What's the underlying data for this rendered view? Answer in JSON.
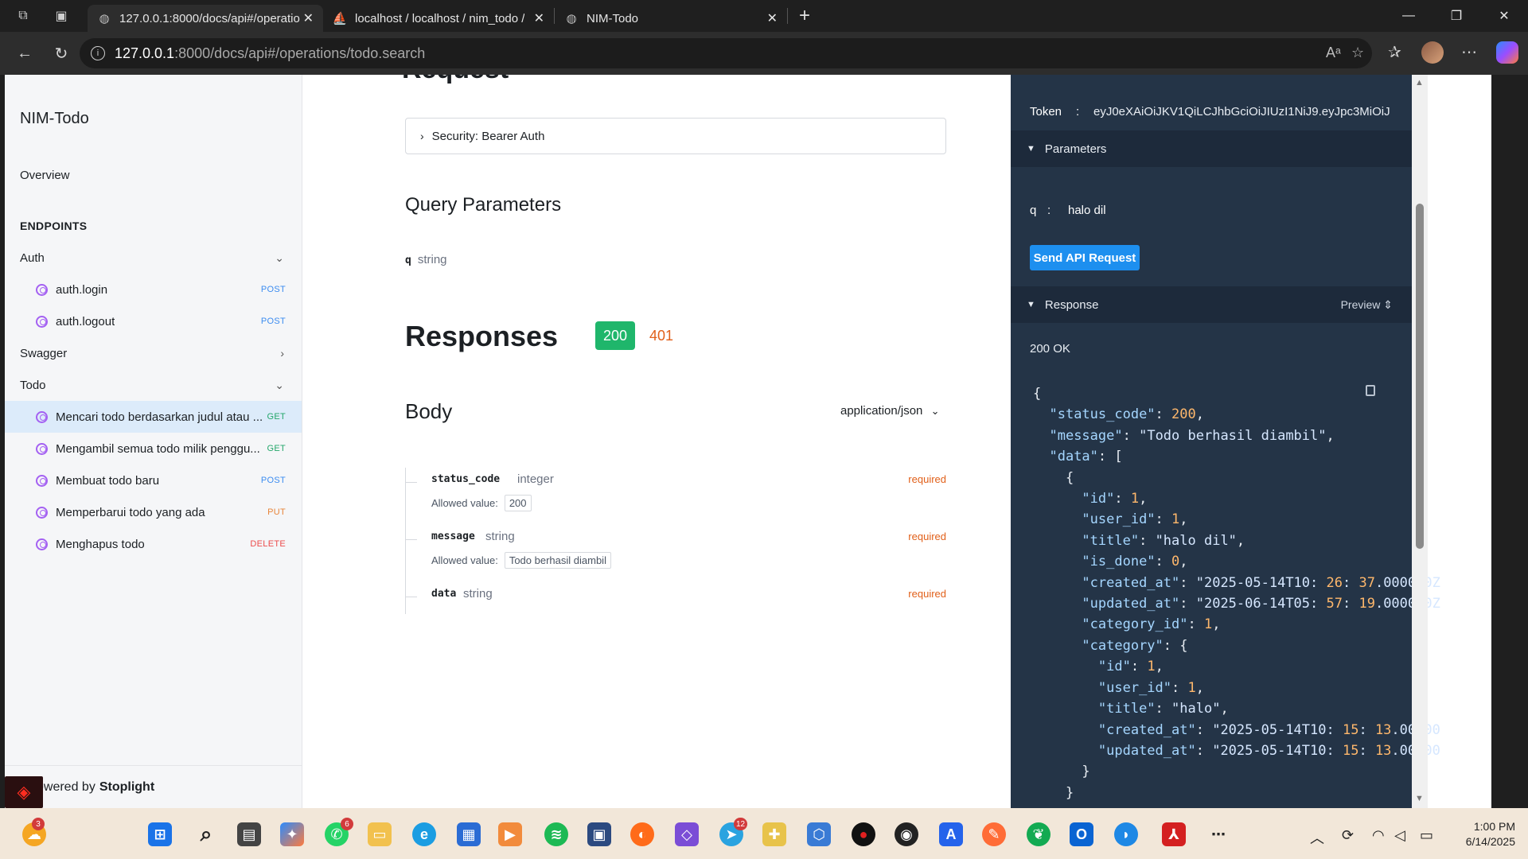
{
  "browser": {
    "tabs": [
      {
        "title": "127.0.0.1:8000/docs/api#/operatio",
        "active": true
      },
      {
        "title": "localhost / localhost / nim_todo /",
        "active": false
      },
      {
        "title": "NIM-Todo",
        "active": false
      }
    ],
    "url_host": "127.0.0.1",
    "url_path": ":8000/docs/api#/operations/todo.search"
  },
  "sidebar": {
    "title": "NIM-Todo",
    "overview": "Overview",
    "endpoints_label": "ENDPOINTS",
    "groups": [
      {
        "label": "Auth",
        "expanded": true,
        "items": [
          {
            "label": "auth.login",
            "method": "POST"
          },
          {
            "label": "auth.logout",
            "method": "POST"
          }
        ]
      },
      {
        "label": "Swagger",
        "expanded": false,
        "items": []
      },
      {
        "label": "Todo",
        "expanded": true,
        "items": [
          {
            "label": "Mencari todo berdasarkan judul atau ...",
            "method": "GET",
            "selected": true
          },
          {
            "label": "Mengambil semua todo milik penggu...",
            "method": "GET"
          },
          {
            "label": "Membuat todo baru",
            "method": "POST"
          },
          {
            "label": "Memperbarui todo yang ada",
            "method": "PUT"
          },
          {
            "label": "Menghapus todo",
            "method": "DELETE"
          }
        ]
      }
    ],
    "powered_prefix": "owered by",
    "powered_brand": "Stoplight"
  },
  "main": {
    "request_heading": "Request",
    "security_label": "Security: Bearer Auth",
    "query_heading": "Query Parameters",
    "query_params": [
      {
        "name": "q",
        "type": "string"
      }
    ],
    "responses_heading": "Responses",
    "codes": [
      "200",
      "401"
    ],
    "body_heading": "Body",
    "content_type": "application/json",
    "fields": [
      {
        "name": "status_code",
        "type": "integer",
        "required": "required",
        "allowed_label": "Allowed value:",
        "allowed": "200"
      },
      {
        "name": "message",
        "type": "string",
        "required": "required",
        "allowed_label": "Allowed value:",
        "allowed": "Todo berhasil diambil"
      },
      {
        "name": "data",
        "type": "string",
        "required": "required"
      }
    ]
  },
  "panel": {
    "token_label": "Token",
    "token_value": "eyJ0eXAiOiJKV1QiLCJhbGciOiJIUzI1NiJ9.eyJpc3MiOiJ",
    "parameters_label": "Parameters",
    "param_name": "q",
    "param_value": "halo dil",
    "send_label": "Send API Request",
    "response_label": "Response",
    "preview_label": "Preview",
    "status": "200 OK",
    "json_lines": [
      "{",
      "  \"status_code\": 200,",
      "  \"message\": \"Todo berhasil diambil\",",
      "  \"data\": [",
      "    {",
      "      \"id\": 1,",
      "      \"user_id\": 1,",
      "      \"title\": \"halo dil\",",
      "      \"is_done\": 0,",
      "      \"created_at\": \"2025-05-14T10:26:37.000000Z",
      "      \"updated_at\": \"2025-06-14T05:57:19.000000Z",
      "      \"category_id\": 1,",
      "      \"category\": {",
      "        \"id\": 1,",
      "        \"user_id\": 1,",
      "        \"title\": \"halo\",",
      "        \"created_at\": \"2025-05-14T10:15:13.00000",
      "        \"updated_at\": \"2025-05-14T10:15:13.00000",
      "      }",
      "    }"
    ]
  },
  "taskbar": {
    "badges": {
      "weather": "3",
      "whatsapp": "6",
      "telegram": "12"
    },
    "time": "1:00 PM",
    "date": "6/14/2025"
  }
}
